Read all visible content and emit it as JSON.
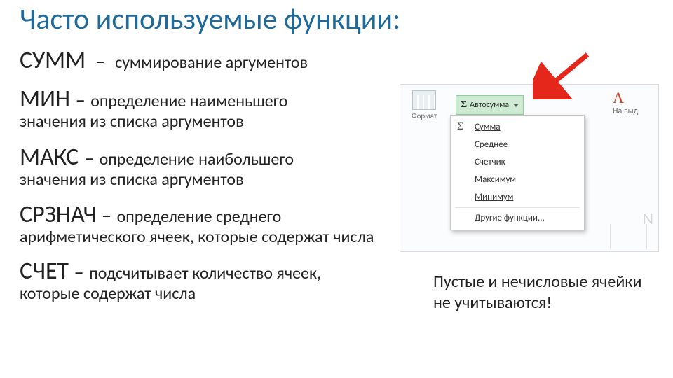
{
  "title": "Часто используемые функции:",
  "functions": [
    {
      "name": "СУММ",
      "desc1": "суммирование аргументов",
      "desc2": ""
    },
    {
      "name": "МИН",
      "desc1": "определение наименьшего",
      "desc2": "значения из списка аргументов"
    },
    {
      "name": "МАКС",
      "desc1": "определение наибольшего",
      "desc2": "значения из списка аргументов"
    },
    {
      "name": "СРЗНАЧ",
      "desc1": "определение среднего",
      "desc2": "арифметического ячеек, которые содержат числа"
    },
    {
      "name": "СЧЕТ",
      "desc1": "подсчитывает количество ячеек,",
      "desc2": "которые содержат числа"
    }
  ],
  "ribbon": {
    "format_label": "Формат",
    "autosum_label": "Автосумма",
    "side_label": "На выд",
    "col_letter": "N",
    "menu": [
      "Сумма",
      "Среднее",
      "Счетчик",
      "Максимум",
      "Минимум",
      "Другие функции..."
    ]
  },
  "note": "Пустые и нечисловые ячейки не учитываются!"
}
